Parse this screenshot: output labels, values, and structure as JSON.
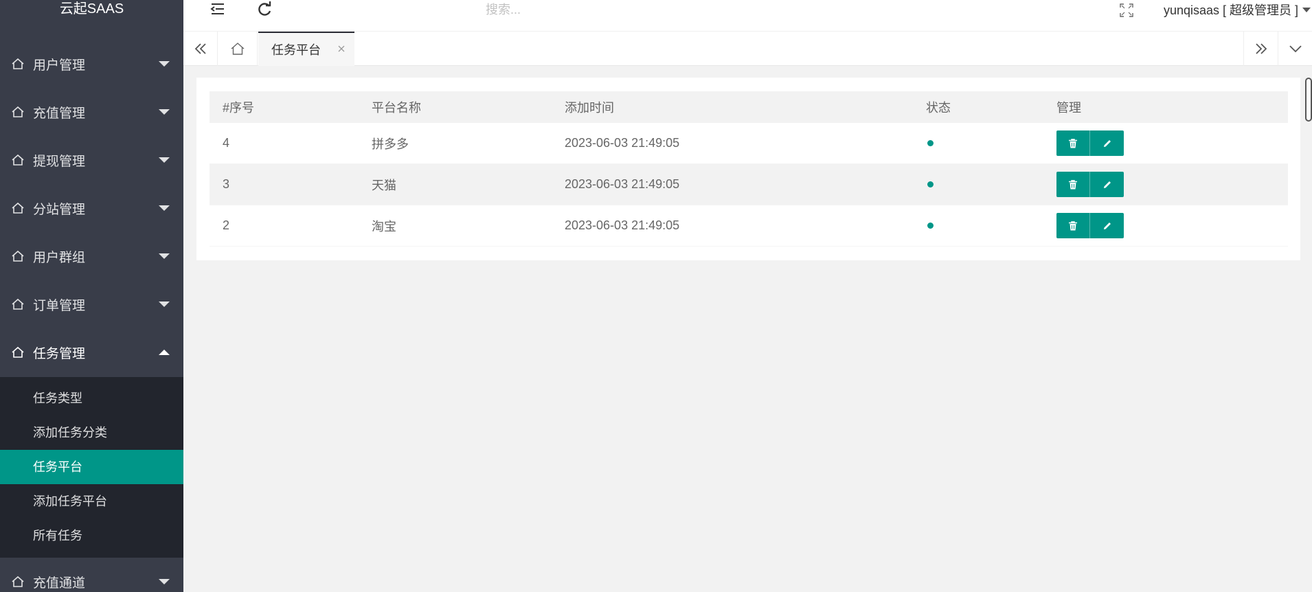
{
  "app": {
    "logo": "云起SAAS"
  },
  "sidebar": {
    "groups": [
      {
        "label": "用户管理"
      },
      {
        "label": "充值管理"
      },
      {
        "label": "提现管理"
      },
      {
        "label": "分站管理"
      },
      {
        "label": "用户群组"
      },
      {
        "label": "订单管理"
      },
      {
        "label": "任务管理"
      },
      {
        "label": "充值通道"
      }
    ],
    "submenu": [
      {
        "label": "任务类型"
      },
      {
        "label": "添加任务分类"
      },
      {
        "label": "任务平台"
      },
      {
        "label": "添加任务平台"
      },
      {
        "label": "所有任务"
      }
    ]
  },
  "header": {
    "search_placeholder": "搜索...",
    "user_label": "yunqisaas [ 超级管理员 ]"
  },
  "tabs": {
    "active_label": "任务平台"
  },
  "table": {
    "headers": [
      "#序号",
      "平台名称",
      "添加时间",
      "状态",
      "管理"
    ],
    "rows": [
      {
        "id": "4",
        "name": "拼多多",
        "time": "2023-06-03 21:49:05"
      },
      {
        "id": "3",
        "name": "天猫",
        "time": "2023-06-03 21:49:05"
      },
      {
        "id": "2",
        "name": "淘宝",
        "time": "2023-06-03 21:49:05"
      }
    ]
  },
  "colors": {
    "sidebar_bg": "#393d49",
    "submenu_bg": "#22252d",
    "accent": "#009688",
    "page_bg": "#f2f2f2"
  }
}
